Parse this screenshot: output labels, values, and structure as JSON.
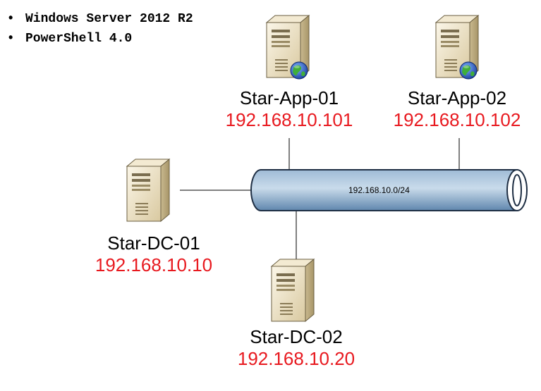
{
  "notes": [
    "Windows Server 2012 R2",
    "PowerShell 4.0"
  ],
  "network": {
    "label": "192.168.10.0/24"
  },
  "servers": {
    "app01": {
      "name": "Star-App-01",
      "ip": "192.168.10.101",
      "icon": "web-server-icon"
    },
    "app02": {
      "name": "Star-App-02",
      "ip": "192.168.10.102",
      "icon": "web-server-icon"
    },
    "dc01": {
      "name": "Star-DC-01",
      "ip": "192.168.10.10",
      "icon": "server-tower-icon"
    },
    "dc02": {
      "name": "Star-DC-02",
      "ip": "192.168.10.20",
      "icon": "server-tower-icon"
    }
  },
  "colors": {
    "ip_text": "#e8191f",
    "bus_fill": "#b7cde2",
    "server_body": "#efe6cf"
  }
}
